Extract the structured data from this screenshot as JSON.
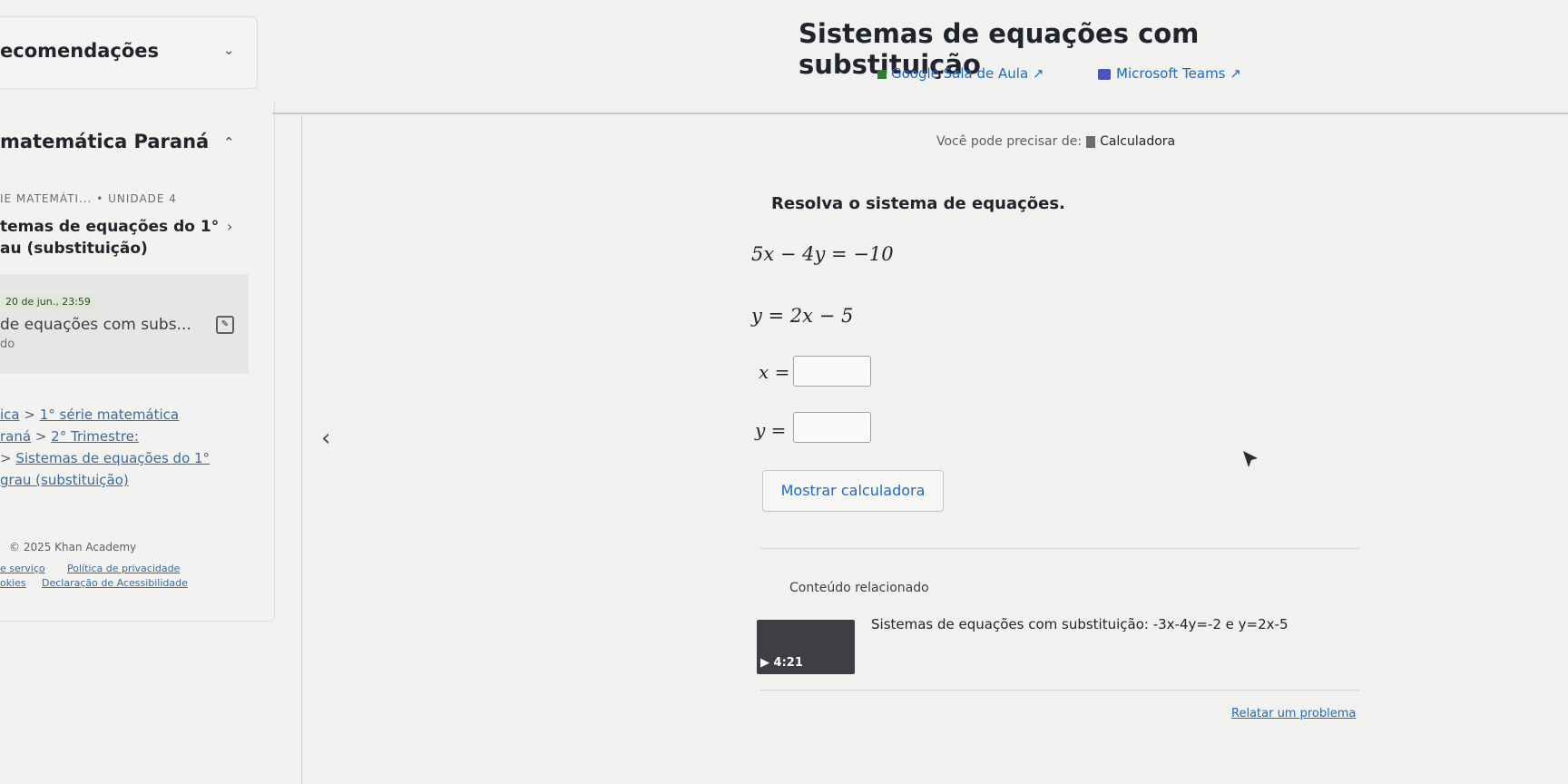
{
  "sidebar": {
    "recommendations_title": "ecomendações",
    "course_title": "matemática Paraná",
    "unit_breadcrumb": "IE MATEMÁTI... • UNIDADE 4",
    "lesson_line1": "temas de equações do 1°",
    "lesson_line2": "au (substituição)",
    "active_item": {
      "date": "20 de jun., 23:59",
      "title": "de equações com subs...",
      "subtitle": "do"
    },
    "breadcrumbs": {
      "c1_prefix": "ica",
      "c1_sep": " > ",
      "c1_link": "1° série matemática",
      "c2_prefix": "raná",
      "c2_sep": " > ",
      "c2_link": "2° Trimestre:",
      "c3_sep": "> ",
      "c3_link": "Sistemas de equações do 1°",
      "c4_link": "grau (substituição)"
    },
    "copyright": "© 2025 Khan Academy",
    "footer_row1": [
      "e serviço",
      "Política de privacidade"
    ],
    "footer_row2": [
      "okies",
      "Declaração de Acessibilidade"
    ]
  },
  "header": {
    "title": "Sistemas de equações com substituição",
    "share_google": "Google Sala de Aula ↗",
    "share_teams": "Microsoft Teams ↗"
  },
  "exercise": {
    "hint_prefix": "Você pode precisar de:",
    "hint_tool": "Calculadora",
    "prompt": "Resolva o sistema de equações.",
    "equation1": "5x − 4y = −10",
    "equation2": "y = 2x − 5",
    "answer_x_label": "x =",
    "answer_y_label": "y =",
    "answer_x_value": "",
    "answer_y_value": "",
    "calculator_button": "Mostrar calculadora"
  },
  "related": {
    "title": "Conteúdo relacionado",
    "video_title": "Sistemas de equações com substituição: -3x-4y=-2 e y=2x-5",
    "video_duration": "▶ 4:21"
  },
  "report_link": "Relatar um problema",
  "icons": {
    "back": "chevron-left-icon",
    "calculator": "calculator-icon",
    "cursor": "mouse-pointer-icon"
  }
}
